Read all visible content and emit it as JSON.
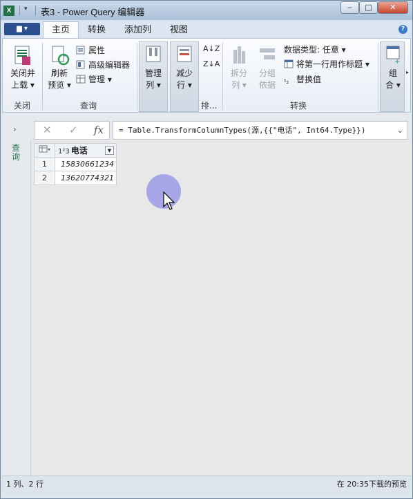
{
  "window": {
    "title": "表3 - Power Query 编辑器",
    "controls": {
      "minimize": "‒",
      "maximize": "□",
      "close": "✕"
    }
  },
  "quick_access": {
    "app_icon": "excel-icon",
    "customize": "▾"
  },
  "file_tab": {
    "label": "▆ ▾"
  },
  "tabs": [
    "主页",
    "转换",
    "添加列",
    "视图"
  ],
  "active_tab": "主页",
  "ribbon": {
    "close_group": {
      "label": "关闭",
      "close_load": {
        "line1": "关闭并",
        "line2": "上载 ▾"
      }
    },
    "query_group": {
      "label": "查询",
      "refresh": {
        "line1": "刷新",
        "line2": "预览 ▾"
      },
      "properties": "属性",
      "advanced_editor": "高级编辑器",
      "manage": "管理 ▾"
    },
    "manage_cols": {
      "line1": "管理",
      "line2": "列 ▾"
    },
    "reduce_rows": {
      "line1": "减少",
      "line2": "行 ▾"
    },
    "sort_group": {
      "label": "排..."
    },
    "transform_group": {
      "label": "转换",
      "split_col": {
        "line1": "拆分",
        "line2": "列 ▾"
      },
      "group_by": {
        "line1": "分组",
        "line2": "依据"
      },
      "data_type": "数据类型: 任意 ▾",
      "first_row_header": "将第一行用作标题 ▾",
      "replace_values": "替换值"
    },
    "combine": {
      "line1": "组",
      "line2": "合 ▾"
    }
  },
  "formula_bar": {
    "cancel": "✕",
    "confirm": "✓",
    "fx": "fx",
    "formula": "= Table.TransformColumnTypes(源,{{\"电话\", Int64.Type}})"
  },
  "queries_pane": {
    "label": "查询",
    "expand": "›"
  },
  "table": {
    "column": {
      "name": "电话",
      "type_icon": "1²3"
    },
    "rows": [
      {
        "n": "1",
        "value": "15830661234"
      },
      {
        "n": "2",
        "value": "13620774321"
      }
    ]
  },
  "status": {
    "left": "1 列、2 行",
    "right": "在 20:35下载的预览"
  }
}
